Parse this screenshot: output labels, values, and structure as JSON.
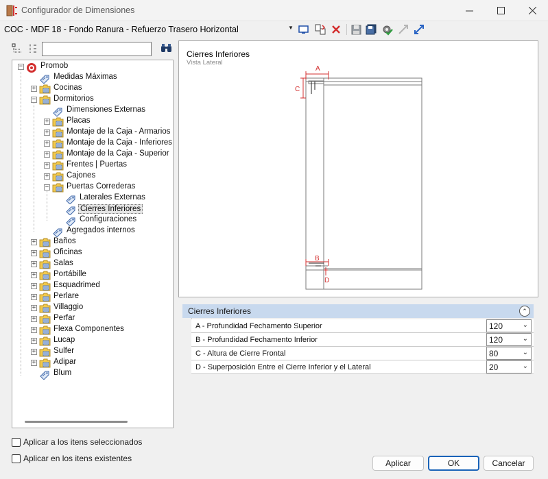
{
  "window": {
    "title": "Configurador de Dimensiones"
  },
  "config": {
    "value": "COC - MDF 18 - Fondo Ranura - Refuerzo Trasero Horizontal"
  },
  "tree": {
    "items": [
      {
        "label": "Promob"
      },
      {
        "label": "Medidas Máximas"
      },
      {
        "label": "Cocinas"
      },
      {
        "label": "Dormitorios"
      },
      {
        "label": "Dimensiones Externas"
      },
      {
        "label": "Placas"
      },
      {
        "label": "Montaje de la Caja - Armarios"
      },
      {
        "label": "Montaje de la Caja - Inferiores | M"
      },
      {
        "label": "Montaje de la Caja - Superior"
      },
      {
        "label": "Frentes | Puertas"
      },
      {
        "label": "Cajones"
      },
      {
        "label": "Puertas Correderas"
      },
      {
        "label": "Laterales Externas"
      },
      {
        "label": "Cierres Inferiores"
      },
      {
        "label": "Configuraciones"
      },
      {
        "label": "Agregados internos"
      },
      {
        "label": "Baños"
      },
      {
        "label": "Oficinas"
      },
      {
        "label": "Salas"
      },
      {
        "label": "Portábille"
      },
      {
        "label": "Esquadrimed"
      },
      {
        "label": "Perlare"
      },
      {
        "label": "Villaggio"
      },
      {
        "label": "Perfar"
      },
      {
        "label": "Flexa Componentes"
      },
      {
        "label": "Lucap"
      },
      {
        "label": "Sulfer"
      },
      {
        "label": "Adipar"
      },
      {
        "label": "Blum"
      }
    ]
  },
  "options": {
    "apply_selected": "Aplicar a los itens seleccionados",
    "apply_existing": "Aplicar en los itens existentes"
  },
  "preview": {
    "title": "Cierres Inferiores",
    "subtitle": "Vista Lateral",
    "labels": {
      "a": "A",
      "b": "B",
      "c": "C",
      "d": "D"
    }
  },
  "properties": {
    "header": "Cierres Inferiores",
    "rows": [
      {
        "label": "A - Profundidad Fechamento Superior",
        "value": "120"
      },
      {
        "label": "B - Profundidad Fechamento Inferior",
        "value": "120"
      },
      {
        "label": "C - Altura de Cierre Frontal",
        "value": "80"
      },
      {
        "label": "D - Superposición Entre el Cierre Inferior y el Lateral",
        "value": "20"
      }
    ]
  },
  "buttons": {
    "apply": "Aplicar",
    "ok": "OK",
    "cancel": "Cancelar"
  },
  "colors": {
    "accent_red": "#d32f2f",
    "header_blue": "#c8d9ee",
    "folder_yellow": "#f2c94c"
  }
}
